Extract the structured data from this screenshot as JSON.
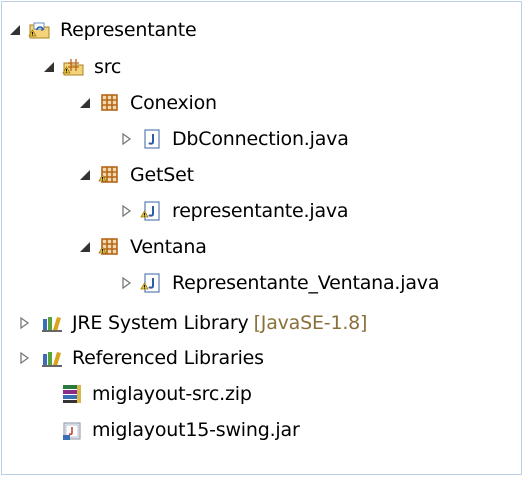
{
  "tree": {
    "project": {
      "label": "Representante",
      "icon": "java-project-folder-icon"
    },
    "src": {
      "label": "src",
      "icon": "source-folder-icon"
    },
    "packages": [
      {
        "label": "Conexion",
        "icon": "package-icon",
        "file": {
          "label": "DbConnection.java",
          "icon": "java-file-icon"
        }
      },
      {
        "label": "GetSet",
        "icon": "package-warning-icon",
        "file": {
          "label": "representante.java",
          "icon": "java-file-warning-icon"
        }
      },
      {
        "label": "Ventana",
        "icon": "package-warning-icon",
        "file": {
          "label": "Representante_Ventana.java",
          "icon": "java-file-warning-icon"
        }
      }
    ],
    "jre": {
      "label": "JRE System Library",
      "decoration": "[JavaSE-1.8]",
      "icon": "library-icon"
    },
    "referenced": {
      "label": "Referenced Libraries",
      "icon": "library-icon"
    },
    "zip": {
      "label": "miglayout-src.zip",
      "icon": "zip-archive-icon"
    },
    "jar": {
      "label": "miglayout15-swing.jar",
      "icon": "jar-file-icon"
    }
  },
  "colors": {
    "decoration": "#8a6f3a",
    "package": "#b5661a",
    "java": "#2d5ca6"
  }
}
